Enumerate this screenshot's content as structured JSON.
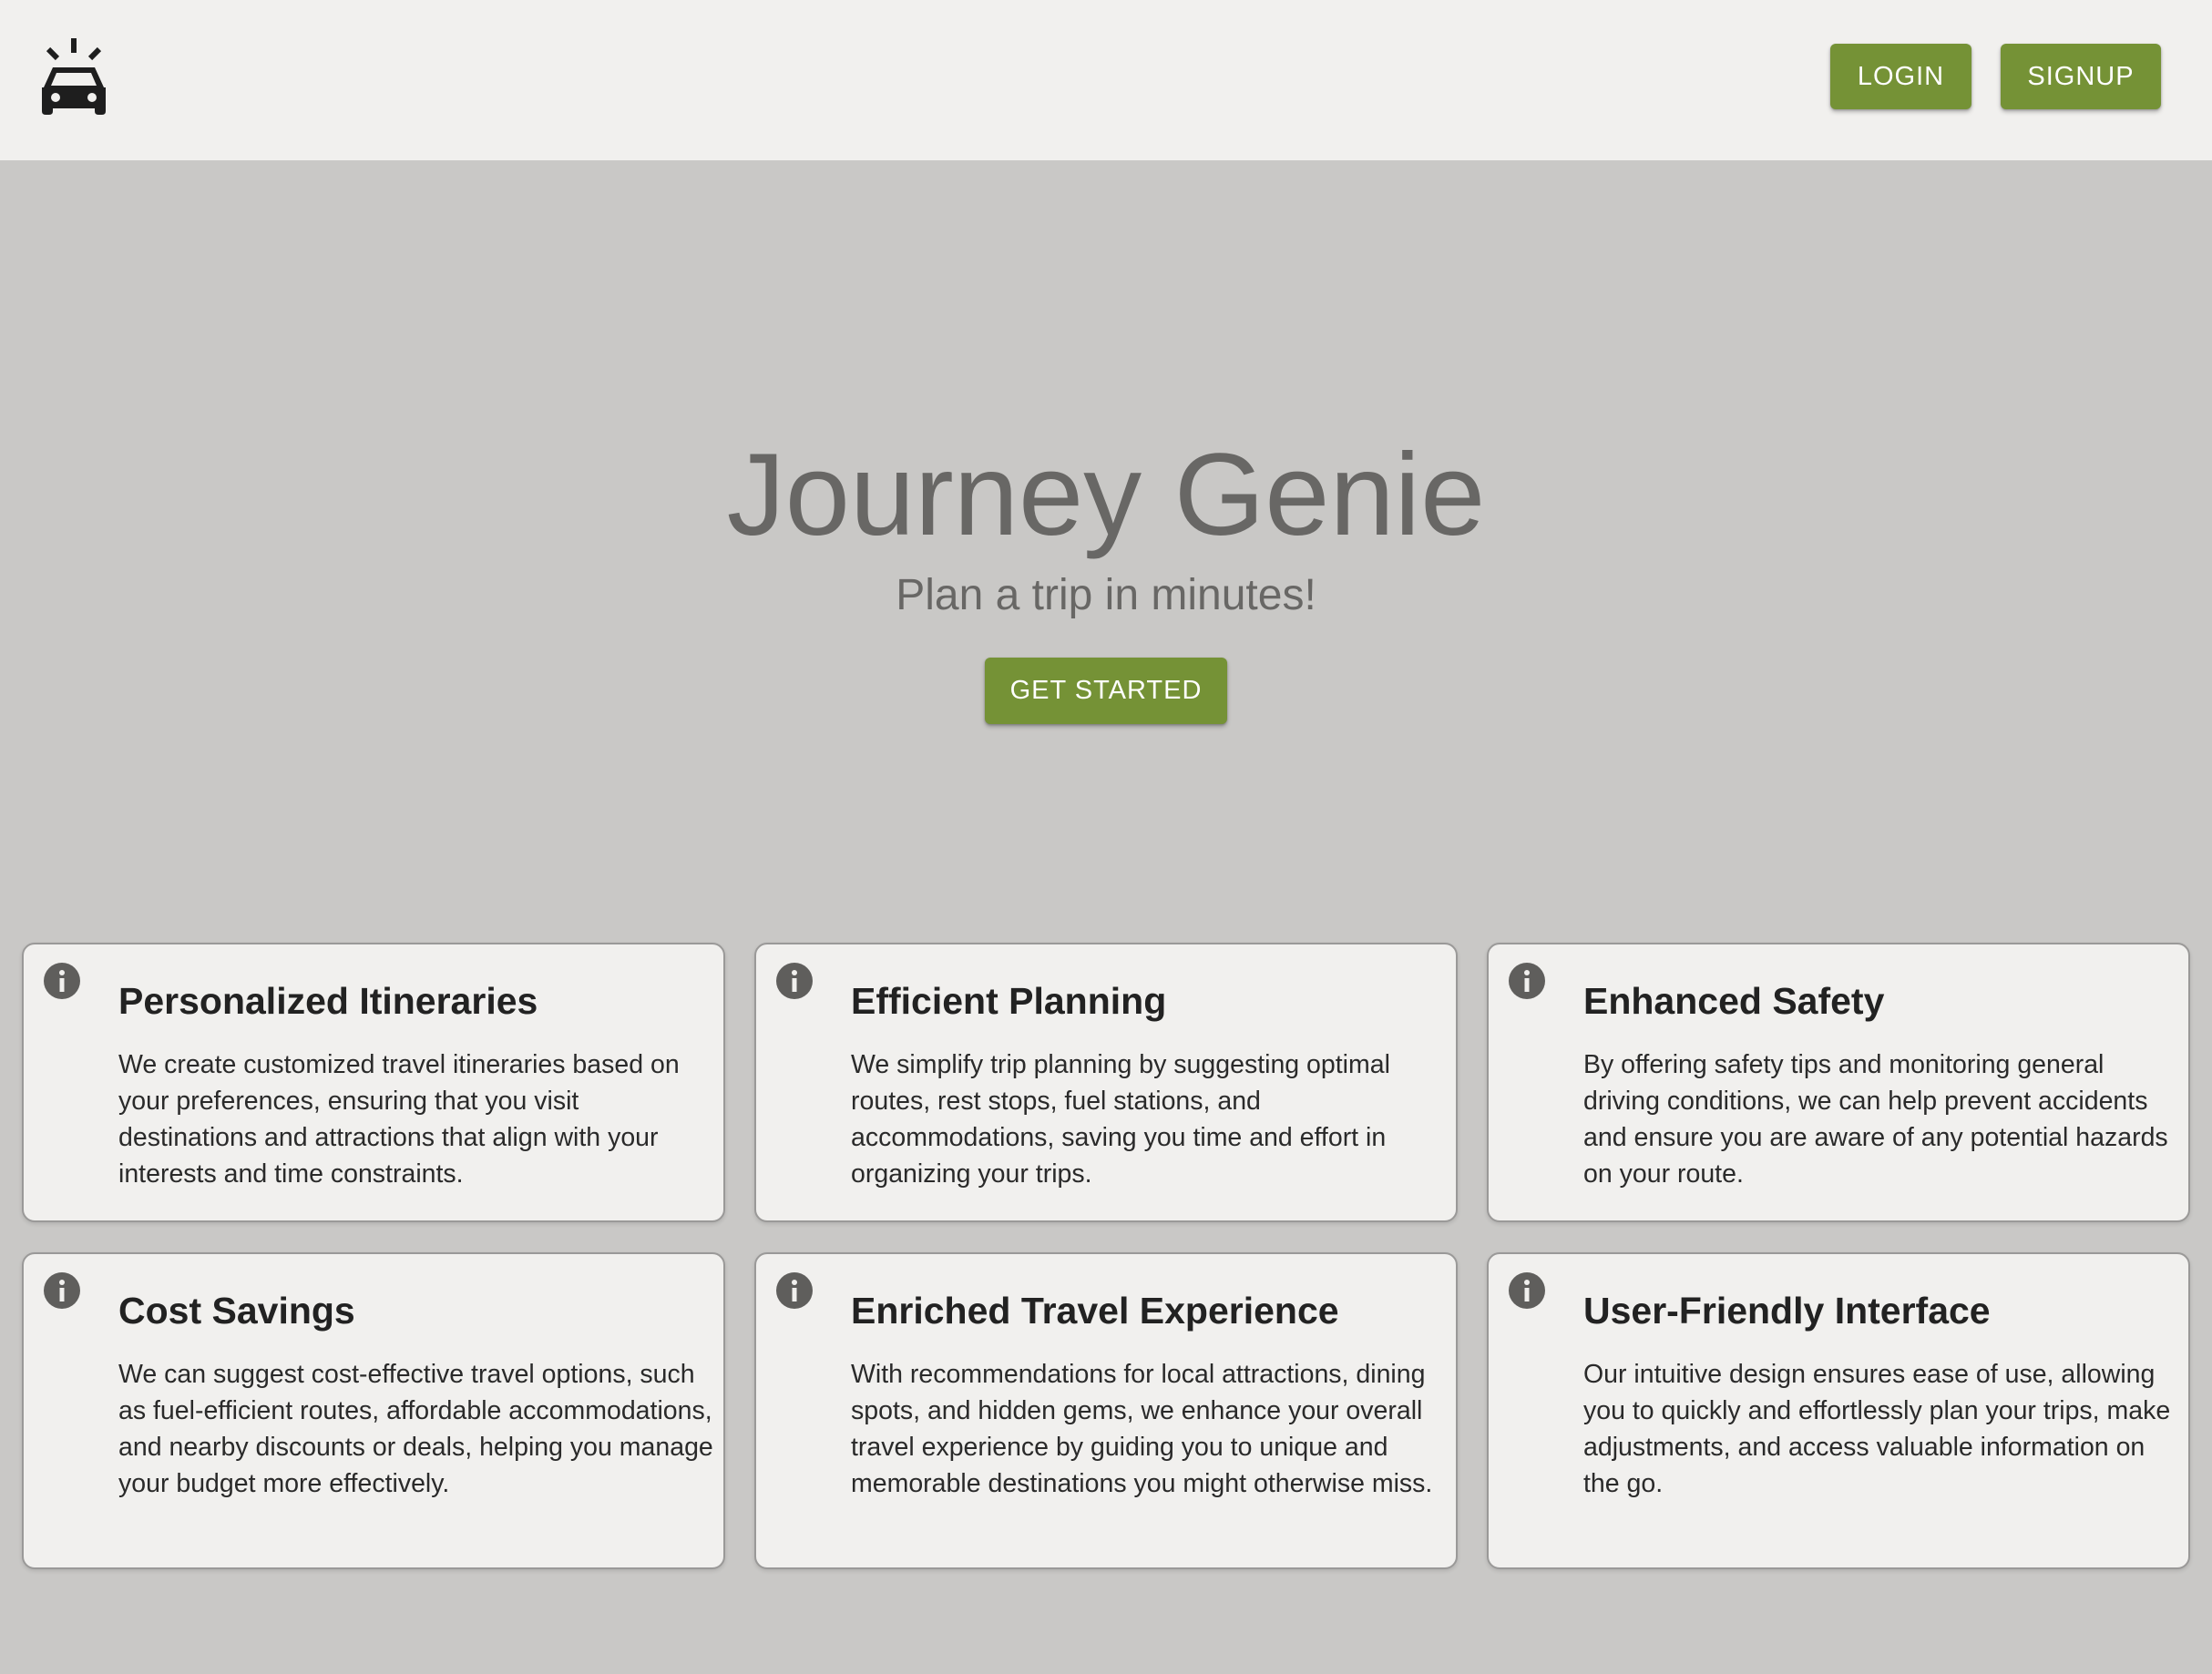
{
  "header": {
    "logo_icon": "car-siren-icon",
    "login_label": "LOGIN",
    "signup_label": "SIGNUP"
  },
  "hero": {
    "title": "Journey Genie",
    "subtitle": "Plan a trip in minutes!",
    "cta_label": "GET STARTED"
  },
  "features": [
    {
      "icon": "info-icon",
      "title": "Personalized Itineraries",
      "text": "We create customized travel itineraries based on your preferences, ensuring that you visit destinations and attractions that align with your interests and time constraints."
    },
    {
      "icon": "info-icon",
      "title": "Efficient Planning",
      "text": "We simplify trip planning by suggesting optimal routes, rest stops, fuel stations, and accommodations, saving you time and effort in organizing your trips."
    },
    {
      "icon": "info-icon",
      "title": "Enhanced Safety",
      "text": "By offering safety tips and monitoring general driving conditions, we can help prevent accidents and ensure you are aware of any potential hazards on your route."
    },
    {
      "icon": "info-icon",
      "title": "Cost Savings",
      "text": "We can suggest cost-effective travel options, such as fuel-efficient routes, affordable accommodations, and nearby discounts or deals, helping you manage your budget more effectively."
    },
    {
      "icon": "info-icon",
      "title": "Enriched Travel Experience",
      "text": "With recommendations for local attractions, dining spots, and hidden gems, we enhance your overall travel experience by guiding you to unique and memorable destinations you might otherwise miss."
    },
    {
      "icon": "info-icon",
      "title": "User-Friendly Interface",
      "text": "Our intuitive design ensures ease of use, allowing you to quickly and effortlessly plan your trips, make adjustments, and access valuable information on the go."
    }
  ],
  "colors": {
    "accent": "#759236",
    "header_bg": "#f1f0ee",
    "page_bg": "#c9c8c6",
    "card_bg": "#f1f0ee",
    "hero_text": "#686765"
  }
}
